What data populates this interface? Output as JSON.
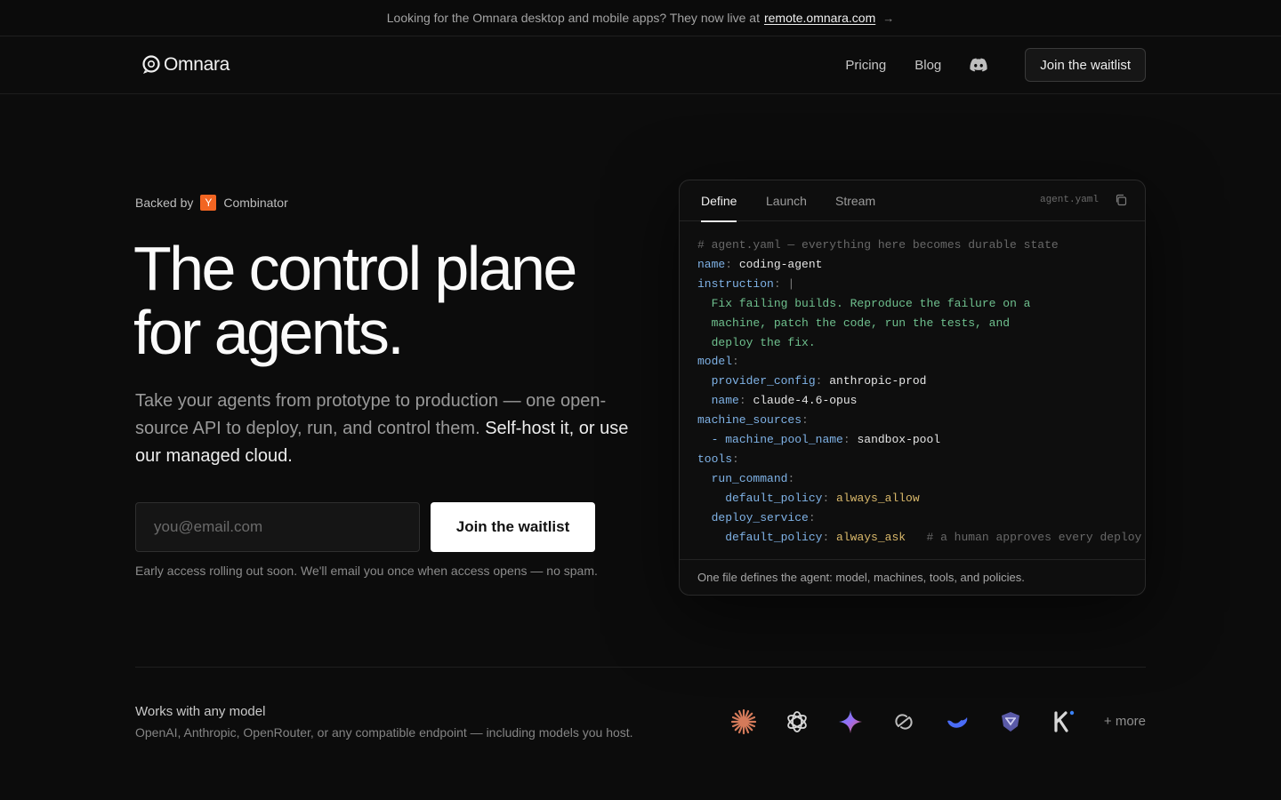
{
  "announcement": {
    "text": "Looking for the Omnara desktop and mobile apps? They now live at",
    "link": "remote.omnara.com",
    "arrow": "→"
  },
  "header": {
    "logo_text": "Omnara",
    "nav": [
      {
        "label": "Pricing"
      },
      {
        "label": "Blog"
      }
    ],
    "waitlist_button": "Join the waitlist"
  },
  "hero": {
    "backed_prefix": "Backed by",
    "yc_letter": "Y",
    "backed_suffix": "Combinator",
    "title_line1": "The control plane",
    "title_line2": "for agents.",
    "subtitle_muted": "Take your agents from prototype to production — one open-source API to deploy, run, and control them.",
    "subtitle_highlight": "Self-host it, or use our managed cloud.",
    "email_placeholder": "you@email.com",
    "cta_label": "Join the waitlist",
    "fine_print": "Early access rolling out soon. We'll email you once when access opens — no spam."
  },
  "card": {
    "tabs": [
      {
        "label": "Define",
        "active": true
      },
      {
        "label": "Launch",
        "active": false
      },
      {
        "label": "Stream",
        "active": false
      }
    ],
    "filename": "agent.yaml",
    "footer": "One file defines the agent: model, machines, tools, and policies.",
    "code": {
      "comment": "# agent.yaml — everything here becomes durable state",
      "name_key": "name",
      "name_val": "coding-agent",
      "instruction_key": "instruction",
      "instruction_pipe": "|",
      "instr_1": "Fix failing builds. Reproduce the failure on a",
      "instr_2": "machine, patch the code, run the tests, and",
      "instr_3": "deploy the fix.",
      "model_key": "model",
      "provider_key": "provider_config",
      "provider_val": "anthropic-prod",
      "model_name_key": "name",
      "model_name_val": "claude-4.6-opus",
      "machine_sources_key": "machine_sources",
      "dash": "-",
      "pool_key": "machine_pool_name",
      "pool_val": "sandbox-pool",
      "tools_key": "tools",
      "run_command_key": "run_command",
      "policy_key_1": "default_policy",
      "policy_val_1": "always_allow",
      "deploy_key": "deploy_service",
      "policy_key_2": "default_policy",
      "policy_val_2": "always_ask",
      "inline_comment": "# a human approves every deploy"
    }
  },
  "models": {
    "title": "Works with any model",
    "subtitle": "OpenAI, Anthropic, OpenRouter, or any compatible endpoint — including models you host.",
    "icons": [
      "anthropic-icon",
      "openai-icon",
      "gemini-icon",
      "openrouter-icon",
      "deepseek-icon",
      "mistral-icon",
      "kimi-icon"
    ],
    "more": "+ more"
  },
  "colors": {
    "background": "#0c0c0c",
    "yc_orange": "#f26522",
    "code_key": "#7fb2e6",
    "code_string": "#6fc08e",
    "code_policy": "#d9b86a"
  }
}
